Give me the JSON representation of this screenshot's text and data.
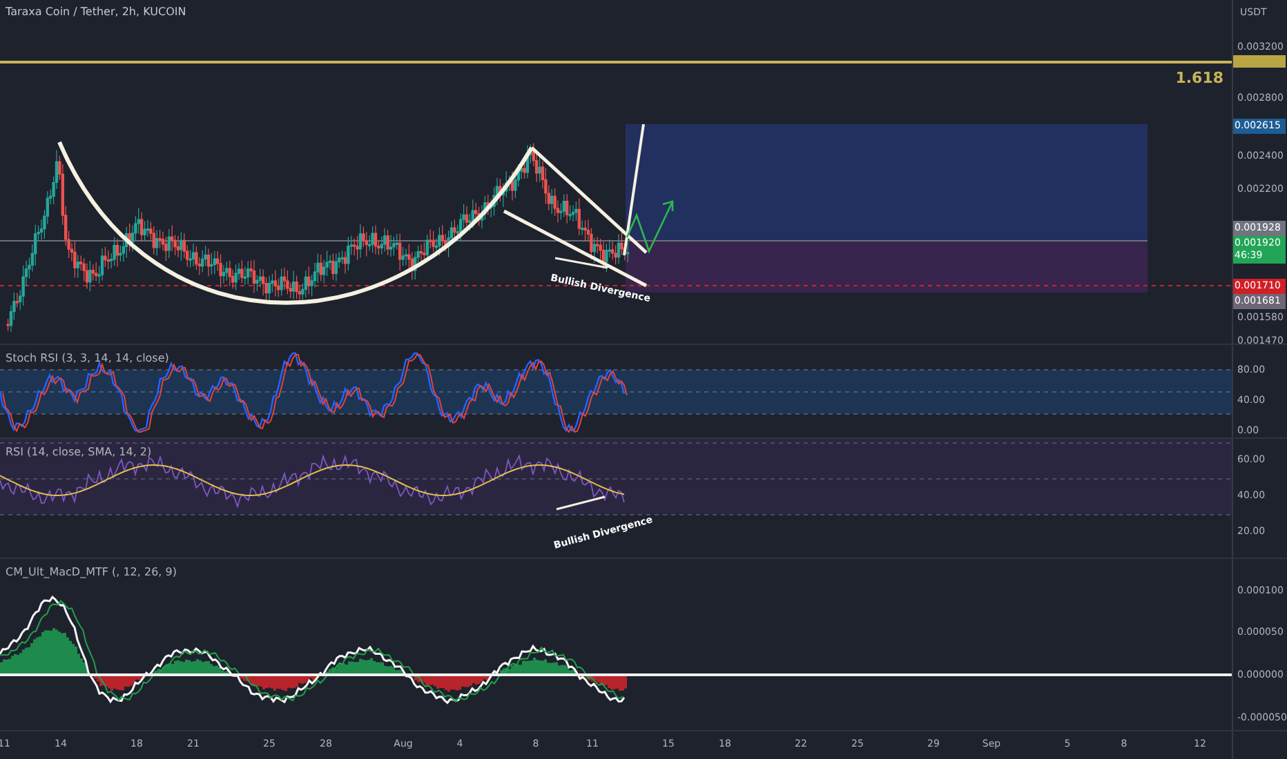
{
  "chart": {
    "title": "Taraxa Coin / Tether, 2h, KUCOIN",
    "fib_label": "1.618",
    "annotation": "Bullish Divergence"
  },
  "price_axis": {
    "unit": "USDT",
    "ticks": [
      "0.003200",
      "0.002800",
      "0.002400",
      "0.002200",
      "0.001580",
      "0.001470"
    ],
    "tags": [
      {
        "color": "#b9a544"
      },
      {
        "text": "0.002615",
        "color": "#1e5d94"
      },
      {
        "text": "0.001928",
        "color": "#70747f"
      },
      {
        "text": "0.001920",
        "sub": "46:39",
        "color": "#22a556"
      },
      {
        "text": "0.001710",
        "color": "#d11f26"
      },
      {
        "text": "0.001681",
        "color": "#6e6676"
      }
    ]
  },
  "indicators": [
    {
      "kind": "stoch",
      "title": "Stoch RSI (3, 3, 14, 14, close)",
      "ticks": [
        "80.00",
        "40.00",
        "0.00"
      ]
    },
    {
      "kind": "rsi",
      "title": "RSI (14, close, SMA, 14, 2)",
      "annotation": "Bullish Divergence",
      "ticks": [
        "60.00",
        "40.00",
        "20.00"
      ]
    },
    {
      "kind": "macd",
      "title": "CM_Ult_MacD_MTF (, 12, 26, 9)",
      "ticks": [
        "0.000100",
        "0.000050",
        "0.000000",
        "-0.000050"
      ]
    }
  ],
  "time_axis": {
    "labels": [
      "11",
      "14",
      "18",
      "21",
      "25",
      "28",
      "Aug",
      "4",
      "8",
      "11",
      "15",
      "18",
      "22",
      "25",
      "29",
      "Sep",
      "5",
      "8",
      "12"
    ]
  }
}
